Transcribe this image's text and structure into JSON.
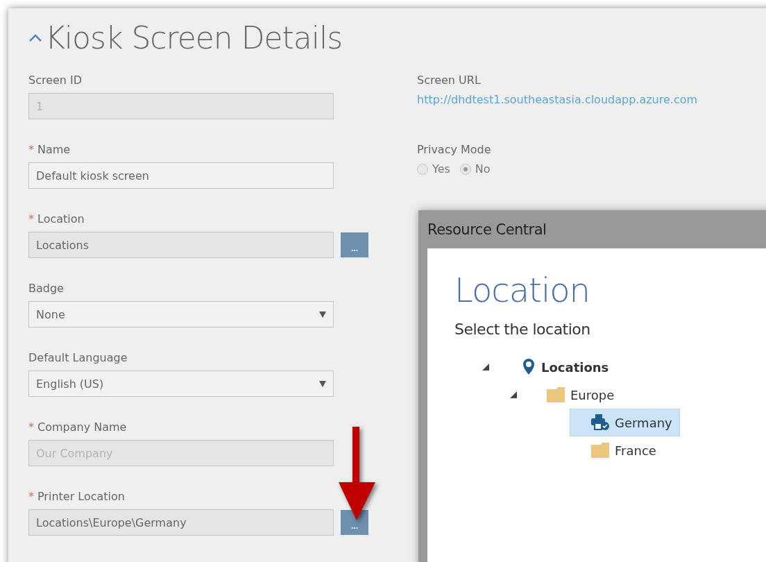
{
  "section": {
    "title": "Kiosk Screen Details",
    "expanded": true
  },
  "fields": [
    {
      "label": "Screen ID",
      "kind": "text",
      "readonly": true,
      "disabled": true,
      "value": "1"
    },
    {
      "required_mark": "*",
      "label": "Name",
      "kind": "text",
      "readonly": false,
      "disabled": false,
      "value": "Default kiosk screen"
    },
    {
      "required_mark": "*",
      "label": "Location",
      "kind": "picker",
      "readonly": true,
      "disabled": false,
      "value": "Locations"
    },
    {
      "label": "Badge",
      "kind": "select",
      "readonly": false,
      "disabled": false,
      "value": "None"
    },
    {
      "label": "Default Language",
      "kind": "select",
      "readonly": false,
      "disabled": false,
      "value": "English (US)"
    },
    {
      "required_mark": "*",
      "label": "Company Name",
      "kind": "text",
      "readonly": true,
      "disabled": true,
      "value": "Our Company"
    },
    {
      "required_mark": "*",
      "label": "Printer Location",
      "kind": "picker",
      "readonly": true,
      "disabled": false,
      "value": "Locations\\Europe\\Germany"
    }
  ],
  "picker_button": "...",
  "screen_url": {
    "label": "Screen URL",
    "link": "http://dhdtest1.southeastasia.cloudapp.azure.com"
  },
  "privacy_mode": {
    "label": "Privacy Mode",
    "options": [
      {
        "label": "Yes",
        "selected": false
      },
      {
        "label": "No",
        "selected": true
      }
    ]
  },
  "dialog": {
    "title": "Resource Central",
    "heading": "Location",
    "prompt": "Select the location",
    "tree": [
      {
        "label": "Locations",
        "kind": "root",
        "expanded": true,
        "selected": false,
        "children": [
          {
            "label": "Europe",
            "kind": "folder",
            "expanded": true,
            "selected": false,
            "children": [
              {
                "label": "Germany",
                "kind": "printer",
                "selected": true
              },
              {
                "label": "France",
                "kind": "folder",
                "selected": false
              }
            ]
          }
        ]
      }
    ]
  }
}
